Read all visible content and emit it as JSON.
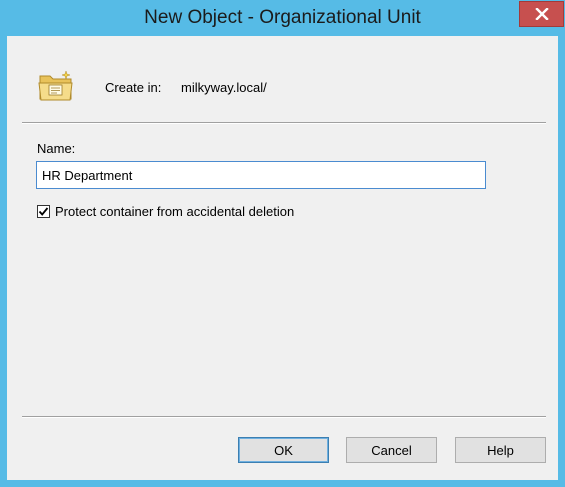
{
  "window": {
    "title": "New Object - Organizational Unit"
  },
  "icons": {
    "close": "close-icon",
    "ou": "organizational-unit-icon",
    "check": "checkmark-icon"
  },
  "create_in": {
    "label": "Create in:",
    "value": "milkyway.local/"
  },
  "name_field": {
    "label": "Name:",
    "value": "HR Department"
  },
  "protect": {
    "label": "Protect container from accidental deletion",
    "checked": true
  },
  "buttons": {
    "ok": "OK",
    "cancel": "Cancel",
    "help": "Help"
  },
  "colors": {
    "titlebar": "#56bbe6",
    "close_button": "#c7504f",
    "client_background": "#f0f0f0",
    "input_focus_border": "#4a8bd0"
  }
}
